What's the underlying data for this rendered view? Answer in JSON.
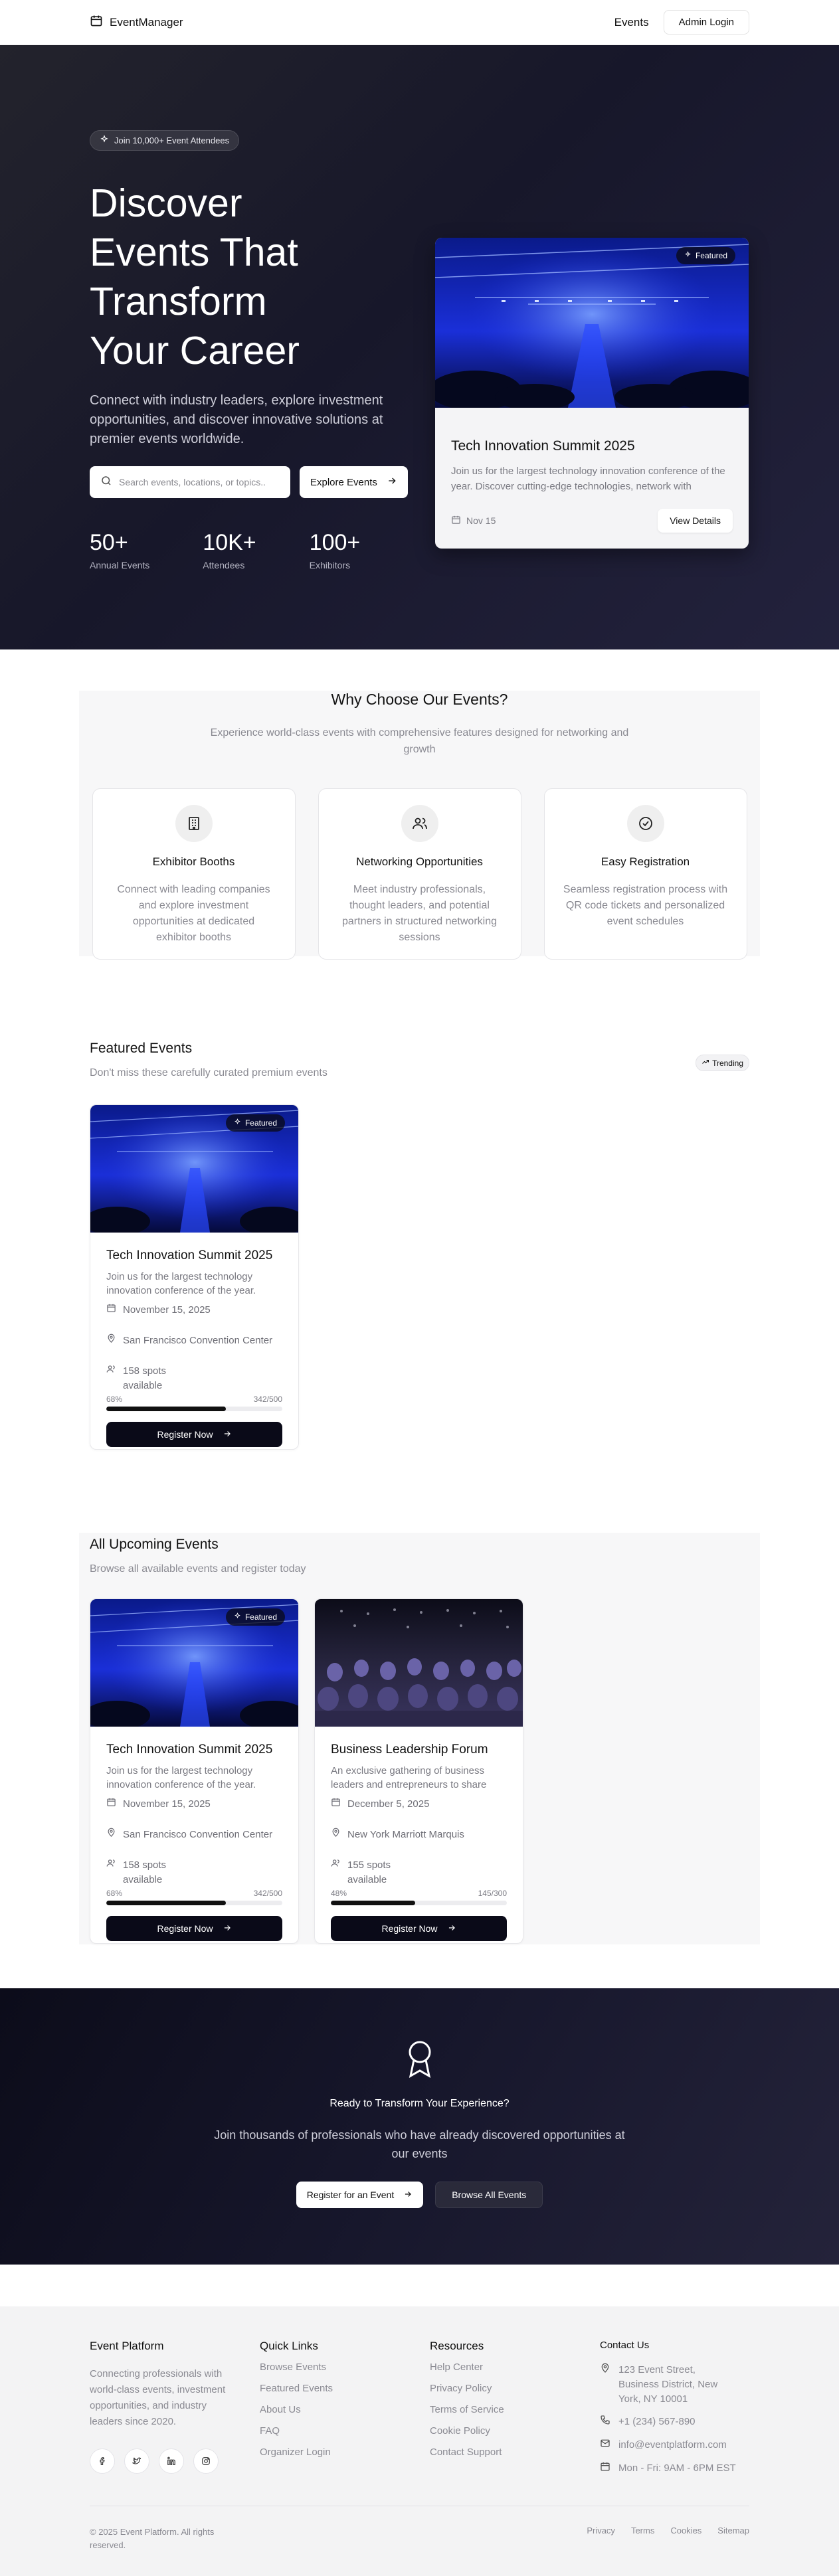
{
  "nav": {
    "brand": "EventManager",
    "events_link": "Events",
    "admin_login": "Admin Login"
  },
  "hero": {
    "badge": "Join 10,000+ Event Attendees",
    "title_lines": [
      "Discover",
      "Events That",
      "Transform",
      "Your Career"
    ],
    "subtitle": "Connect with industry leaders, explore investment opportunities, and discover innovative solutions at premier events worldwide.",
    "search_placeholder": "Search events, locations, or topics...",
    "explore_button": "Explore Events",
    "stats": [
      {
        "value": "50+",
        "label": "Annual Events"
      },
      {
        "value": "10K+",
        "label": "Attendees"
      },
      {
        "value": "100+",
        "label": "Exhibitors"
      }
    ],
    "card": {
      "badge": "Featured",
      "title": "Tech Innovation Summit 2025",
      "description": "Join us for the largest technology innovation conference of the year. Discover cutting-edge technologies, network with",
      "date": "Nov 15",
      "button": "View Details"
    }
  },
  "why": {
    "title": "Why Choose Our Events?",
    "subtitle": "Experience world-class events with comprehensive features designed for networking and growth",
    "features": [
      {
        "icon": "building-icon",
        "title": "Exhibitor Booths",
        "desc": "Connect with leading companies and explore investment opportunities at dedicated exhibitor booths"
      },
      {
        "icon": "users-icon",
        "title": "Networking Opportunities",
        "desc": "Meet industry professionals, thought leaders, and potential partners in structured networking sessions"
      },
      {
        "icon": "check-circle-icon",
        "title": "Easy Registration",
        "desc": "Seamless registration process with QR code tickets and personalized event schedules"
      }
    ]
  },
  "featured": {
    "title": "Featured Events",
    "subtitle": "Don't miss these carefully curated premium events",
    "trending": "Trending",
    "events": [
      {
        "badge": "Featured",
        "title": "Tech Innovation Summit 2025",
        "desc": "Join us for the largest technology innovation conference of the year.",
        "date": "November 15, 2025",
        "location": "San Francisco Convention Center",
        "spots": "158 spots available",
        "percent_label": "68%",
        "capacity": "342/500",
        "fill": 0.68,
        "button": "Register Now"
      }
    ]
  },
  "upcoming": {
    "title": "All Upcoming Events",
    "subtitle": "Browse all available events and register today",
    "events": [
      {
        "badge": "Featured",
        "title": "Tech Innovation Summit 2025",
        "desc": "Join us for the largest technology innovation conference of the year.",
        "date": "November 15, 2025",
        "location": "San Francisco Convention Center",
        "spots": "158 spots available",
        "percent_label": "68%",
        "capacity": "342/500",
        "fill": 0.68,
        "button": "Register Now"
      },
      {
        "badge": "",
        "title": "Business Leadership Forum",
        "desc": "An exclusive gathering of business leaders and entrepreneurs to share",
        "date": "December 5, 2025",
        "location": "New York Marriott Marquis",
        "spots": "155 spots available",
        "percent_label": "48%",
        "capacity": "145/300",
        "fill": 0.48,
        "button": "Register Now"
      }
    ]
  },
  "cta": {
    "title": "Ready to Transform Your Experience?",
    "subtitle": "Join thousands of professionals who have already discovered opportunities at our events",
    "primary": "Register for an Event",
    "secondary": "Browse All Events"
  },
  "footer": {
    "platform": {
      "title": "Event Platform",
      "text": "Connecting professionals with world-class events, investment opportunities, and industry leaders since 2020."
    },
    "socials": [
      "facebook-icon",
      "twitter-icon",
      "linkedin-icon",
      "instagram-icon"
    ],
    "quick_links": {
      "title": "Quick Links",
      "items": [
        "Browse Events",
        "Featured Events",
        "About Us",
        "FAQ",
        "Organizer Login"
      ]
    },
    "resources": {
      "title": "Resources",
      "items": [
        "Help Center",
        "Privacy Policy",
        "Terms of Service",
        "Cookie Policy",
        "Contact Support"
      ]
    },
    "contact": {
      "title": "Contact Us",
      "address": "123 Event Street, Business District, New York, NY 10001",
      "phone": "+1 (234) 567-890",
      "email": "info@eventplatform.com",
      "hours": "Mon - Fri: 9AM - 6PM EST"
    },
    "copyright": "© 2025 Event Platform. All rights reserved.",
    "legal": [
      "Privacy",
      "Terms",
      "Cookies",
      "Sitemap"
    ]
  }
}
